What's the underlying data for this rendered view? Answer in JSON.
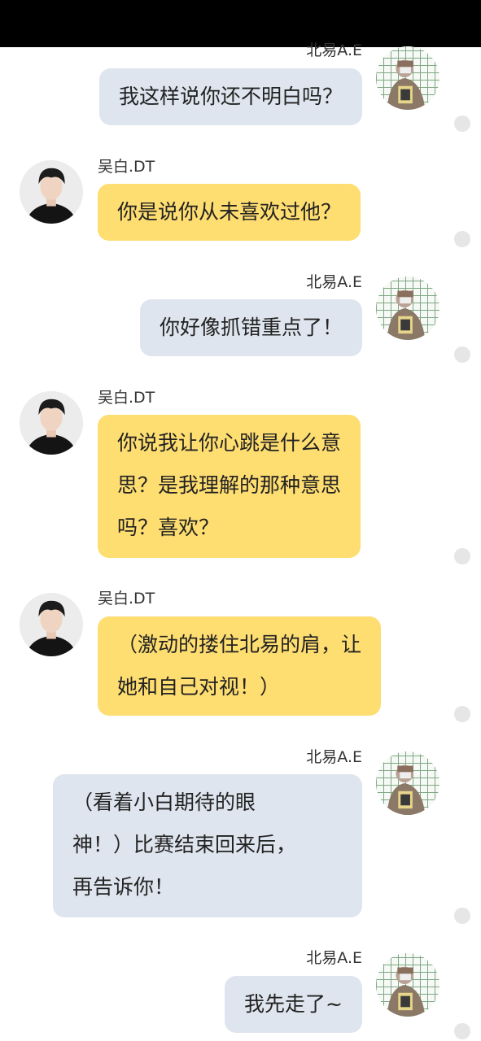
{
  "messages": [
    {
      "sender": "北易A.E",
      "side": "right",
      "lines": [
        "我这样说你还不明白吗？"
      ]
    },
    {
      "sender": "吴白.DT",
      "side": "left",
      "lines": [
        "你是说你从未喜欢过他？"
      ]
    },
    {
      "sender": "北易A.E",
      "side": "right",
      "lines": [
        "你好像抓错重点了！"
      ]
    },
    {
      "sender": "吴白.DT",
      "side": "left",
      "lines": [
        "你说我让你心跳是什么意",
        "思？是我理解的那种意思",
        "吗？喜欢？"
      ]
    },
    {
      "sender": "吴白.DT",
      "side": "left",
      "lines": [
        "（激动的搂住北易的肩，让",
        "她和自己对视！）"
      ]
    },
    {
      "sender": "北易A.E",
      "side": "right",
      "lines": [
        "（看着小白期待的眼",
        "神！）比赛结束回来后，",
        "再告诉你！"
      ]
    },
    {
      "sender": "北易A.E",
      "side": "right",
      "lines": [
        "我先走了~"
      ]
    }
  ],
  "colors": {
    "self_bubble": "#dfe5ee",
    "other_bubble": "#fedd71",
    "top_bar": "#000000",
    "side_dot": "#e6e6e6"
  },
  "icons": {
    "boy_avatar": "avatar-photo-young-man",
    "girl_avatar": "avatar-photo-girl-grid",
    "side_dot": "circle-dot"
  }
}
